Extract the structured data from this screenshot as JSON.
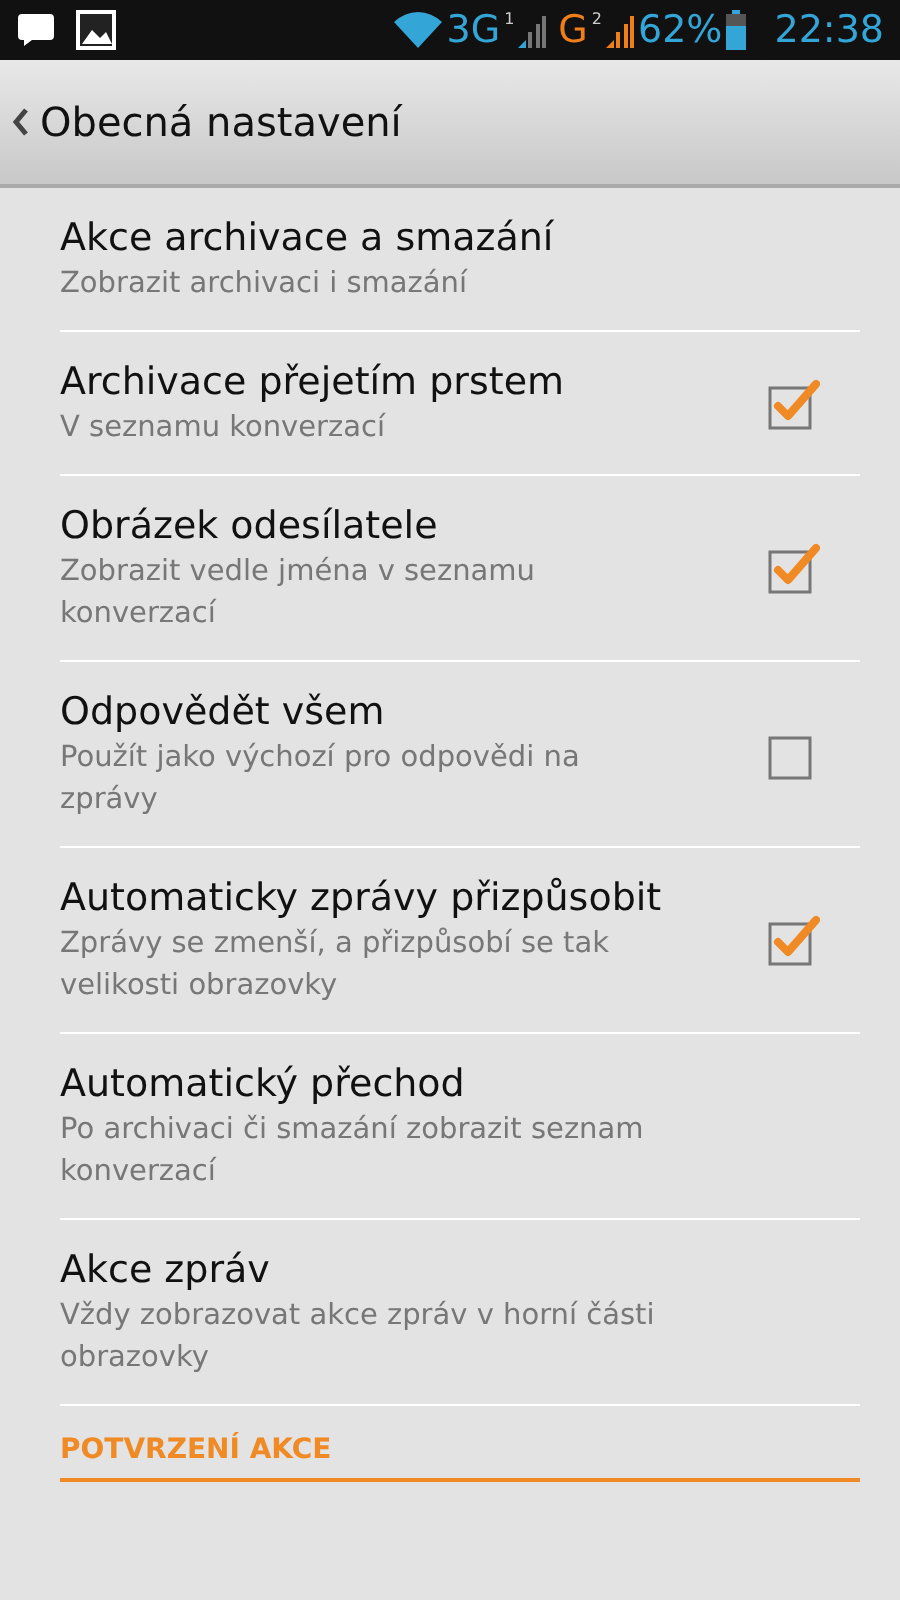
{
  "status_bar": {
    "network": "3G",
    "sim1": "1",
    "network2": "G",
    "sim2": "2",
    "battery": "62%",
    "time": "22:38"
  },
  "header": {
    "title": "Obecná nastavení"
  },
  "settings": [
    {
      "kind": "plain",
      "title": "Akce archivace a smazání",
      "summary": "Zobrazit archivaci i smazání"
    },
    {
      "kind": "checkbox",
      "title": "Archivace přejetím prstem",
      "summary": "V seznamu konverzací",
      "checked": true
    },
    {
      "kind": "checkbox",
      "title": "Obrázek odesílatele",
      "summary": "Zobrazit vedle jména v seznamu konverzací",
      "checked": true
    },
    {
      "kind": "checkbox",
      "title": "Odpovědět všem",
      "summary": "Použít jako výchozí pro odpovědi na zprávy",
      "checked": false
    },
    {
      "kind": "checkbox",
      "title": "Automaticky zprávy přizpůsobit",
      "summary": "Zprávy se zmenší, a přizpůsobí se tak velikosti obrazovky",
      "checked": true
    },
    {
      "kind": "plain",
      "title": "Automatický přechod",
      "summary": "Po archivaci či smazání zobrazit seznam konverzací"
    },
    {
      "kind": "plain",
      "title": "Akce zpráv",
      "summary": "Vždy zobrazovat akce zpráv v horní části obrazovky"
    }
  ],
  "section": {
    "title": "POTVRZENÍ AKCE"
  }
}
